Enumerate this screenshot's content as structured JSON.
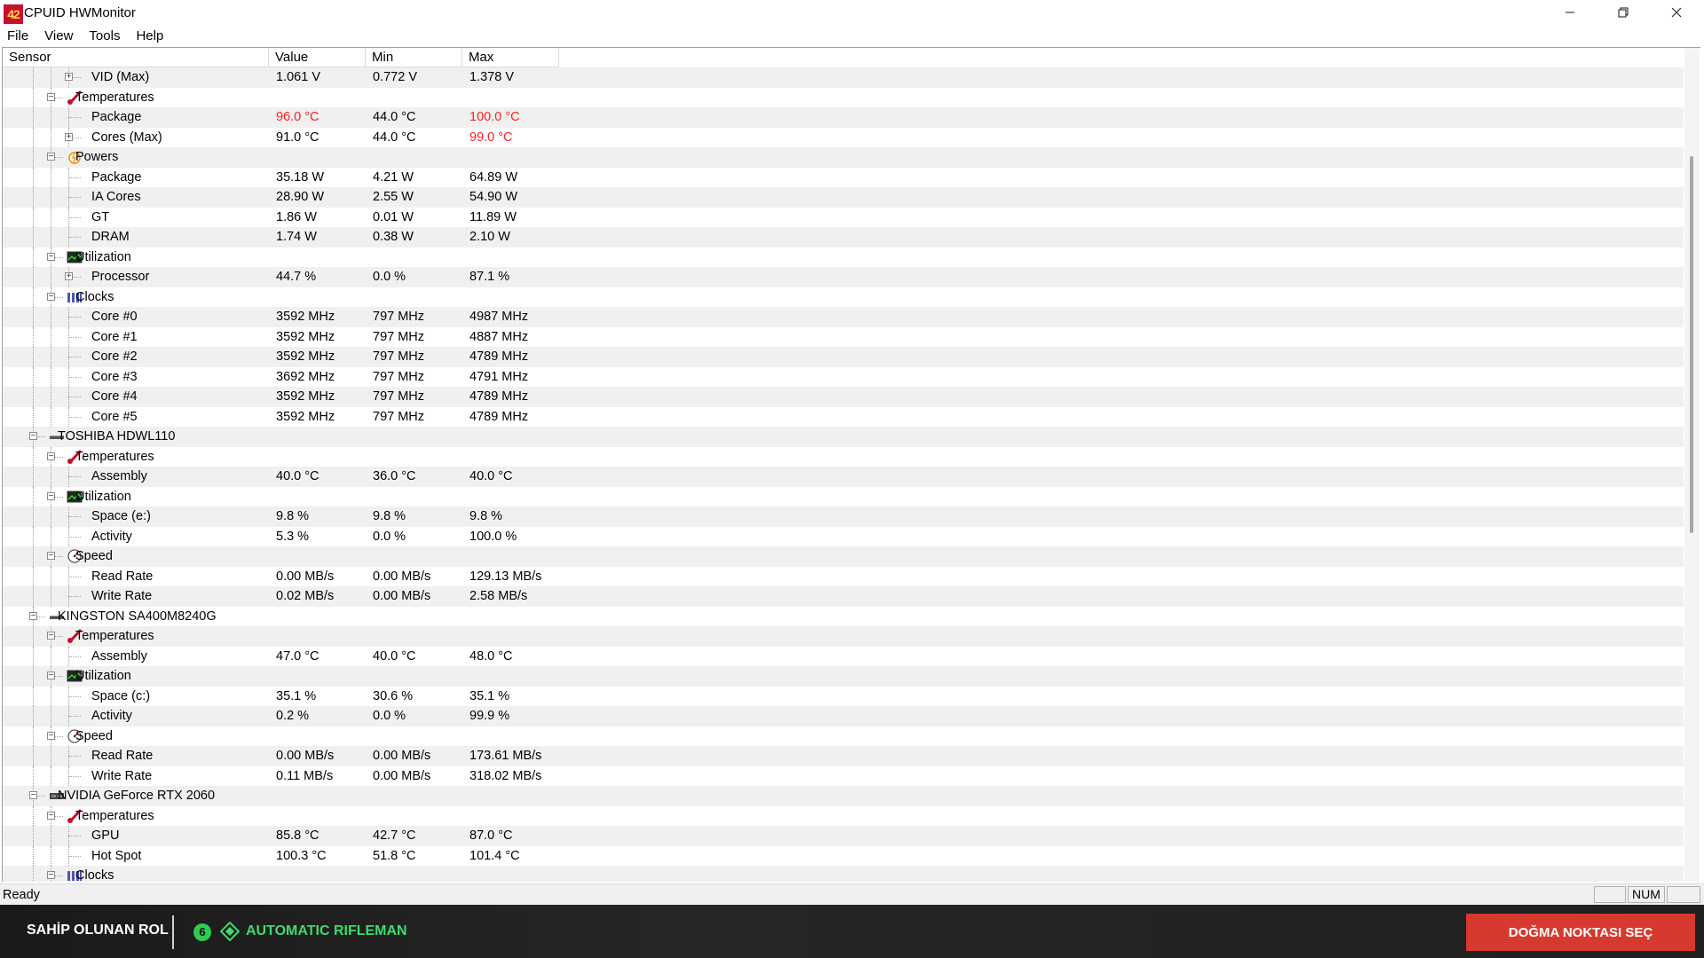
{
  "window": {
    "title": "CPUID HWMonitor",
    "icon_text": "42",
    "controls": [
      "minimize-icon",
      "restore-icon",
      "close-icon"
    ]
  },
  "menu": [
    "File",
    "View",
    "Tools",
    "Help"
  ],
  "columns": [
    "Sensor",
    "Value",
    "Min",
    "Max"
  ],
  "rows": [
    {
      "level": 3,
      "exp": "+",
      "icon": "",
      "name": "VID (Max)",
      "value": "1.061 V",
      "min": "0.772 V",
      "max": "1.378 V"
    },
    {
      "level": 2,
      "exp": "-",
      "icon": "thermometer-icon",
      "name": "Temperatures",
      "value": "",
      "min": "",
      "max": ""
    },
    {
      "level": 3,
      "exp": "",
      "icon": "",
      "name": "Package",
      "value": "96.0 °C",
      "min": "44.0 °C",
      "max": "100.0 °C",
      "value_red": true,
      "max_red": true
    },
    {
      "level": 3,
      "exp": "+",
      "icon": "",
      "name": "Cores (Max)",
      "value": "91.0 °C",
      "min": "44.0 °C",
      "max": "99.0 °C",
      "max_red": true
    },
    {
      "level": 2,
      "exp": "-",
      "icon": "power-icon",
      "name": "Powers",
      "value": "",
      "min": "",
      "max": ""
    },
    {
      "level": 3,
      "exp": "",
      "icon": "",
      "name": "Package",
      "value": "35.18 W",
      "min": "4.21 W",
      "max": "64.89 W"
    },
    {
      "level": 3,
      "exp": "",
      "icon": "",
      "name": "IA Cores",
      "value": "28.90 W",
      "min": "2.55 W",
      "max": "54.90 W"
    },
    {
      "level": 3,
      "exp": "",
      "icon": "",
      "name": "GT",
      "value": "1.86 W",
      "min": "0.01 W",
      "max": "11.89 W"
    },
    {
      "level": 3,
      "exp": "",
      "icon": "",
      "name": "DRAM",
      "value": "1.74 W",
      "min": "0.38 W",
      "max": "2.10 W"
    },
    {
      "level": 2,
      "exp": "-",
      "icon": "utilization-icon",
      "name": "Utilization",
      "value": "",
      "min": "",
      "max": ""
    },
    {
      "level": 3,
      "exp": "+",
      "icon": "",
      "name": "Processor",
      "value": "44.7 %",
      "min": "0.0 %",
      "max": "87.1 %"
    },
    {
      "level": 2,
      "exp": "-",
      "icon": "clock-icon",
      "name": "Clocks",
      "value": "",
      "min": "",
      "max": ""
    },
    {
      "level": 3,
      "exp": "",
      "icon": "",
      "name": "Core #0",
      "value": "3592 MHz",
      "min": "797 MHz",
      "max": "4987 MHz"
    },
    {
      "level": 3,
      "exp": "",
      "icon": "",
      "name": "Core #1",
      "value": "3592 MHz",
      "min": "797 MHz",
      "max": "4887 MHz"
    },
    {
      "level": 3,
      "exp": "",
      "icon": "",
      "name": "Core #2",
      "value": "3592 MHz",
      "min": "797 MHz",
      "max": "4789 MHz"
    },
    {
      "level": 3,
      "exp": "",
      "icon": "",
      "name": "Core #3",
      "value": "3692 MHz",
      "min": "797 MHz",
      "max": "4791 MHz"
    },
    {
      "level": 3,
      "exp": "",
      "icon": "",
      "name": "Core #4",
      "value": "3592 MHz",
      "min": "797 MHz",
      "max": "4789 MHz"
    },
    {
      "level": 3,
      "exp": "",
      "icon": "",
      "name": "Core #5",
      "value": "3592 MHz",
      "min": "797 MHz",
      "max": "4789 MHz"
    },
    {
      "level": 1,
      "exp": "-",
      "icon": "drive-icon",
      "name": "TOSHIBA HDWL110",
      "value": "",
      "min": "",
      "max": ""
    },
    {
      "level": 2,
      "exp": "-",
      "icon": "thermometer-icon",
      "name": "Temperatures",
      "value": "",
      "min": "",
      "max": ""
    },
    {
      "level": 3,
      "exp": "",
      "icon": "",
      "name": "Assembly",
      "value": "40.0 °C",
      "min": "36.0 °C",
      "max": "40.0 °C"
    },
    {
      "level": 2,
      "exp": "-",
      "icon": "utilization-icon",
      "name": "Utilization",
      "value": "",
      "min": "",
      "max": ""
    },
    {
      "level": 3,
      "exp": "",
      "icon": "",
      "name": "Space (e:)",
      "value": "9.8 %",
      "min": "9.8 %",
      "max": "9.8 %"
    },
    {
      "level": 3,
      "exp": "",
      "icon": "",
      "name": "Activity",
      "value": "5.3 %",
      "min": "0.0 %",
      "max": "100.0 %"
    },
    {
      "level": 2,
      "exp": "-",
      "icon": "speed-icon",
      "name": "Speed",
      "value": "",
      "min": "",
      "max": ""
    },
    {
      "level": 3,
      "exp": "",
      "icon": "",
      "name": "Read Rate",
      "value": "0.00 MB/s",
      "min": "0.00 MB/s",
      "max": "129.13 MB/s"
    },
    {
      "level": 3,
      "exp": "",
      "icon": "",
      "name": "Write Rate",
      "value": "0.02 MB/s",
      "min": "0.00 MB/s",
      "max": "2.58 MB/s"
    },
    {
      "level": 1,
      "exp": "-",
      "icon": "drive-icon",
      "name": "KINGSTON SA400M8240G",
      "value": "",
      "min": "",
      "max": ""
    },
    {
      "level": 2,
      "exp": "-",
      "icon": "thermometer-icon",
      "name": "Temperatures",
      "value": "",
      "min": "",
      "max": ""
    },
    {
      "level": 3,
      "exp": "",
      "icon": "",
      "name": "Assembly",
      "value": "47.0 °C",
      "min": "40.0 °C",
      "max": "48.0 °C"
    },
    {
      "level": 2,
      "exp": "-",
      "icon": "utilization-icon",
      "name": "Utilization",
      "value": "",
      "min": "",
      "max": ""
    },
    {
      "level": 3,
      "exp": "",
      "icon": "",
      "name": "Space (c:)",
      "value": "35.1 %",
      "min": "30.6 %",
      "max": "35.1 %"
    },
    {
      "level": 3,
      "exp": "",
      "icon": "",
      "name": "Activity",
      "value": "0.2 %",
      "min": "0.0 %",
      "max": "99.9 %"
    },
    {
      "level": 2,
      "exp": "-",
      "icon": "speed-icon",
      "name": "Speed",
      "value": "",
      "min": "",
      "max": ""
    },
    {
      "level": 3,
      "exp": "",
      "icon": "",
      "name": "Read Rate",
      "value": "0.00 MB/s",
      "min": "0.00 MB/s",
      "max": "173.61 MB/s"
    },
    {
      "level": 3,
      "exp": "",
      "icon": "",
      "name": "Write Rate",
      "value": "0.11 MB/s",
      "min": "0.00 MB/s",
      "max": "318.02 MB/s"
    },
    {
      "level": 1,
      "exp": "-",
      "icon": "gpu-icon",
      "name": "NVIDIA GeForce RTX 2060",
      "value": "",
      "min": "",
      "max": ""
    },
    {
      "level": 2,
      "exp": "-",
      "icon": "thermometer-icon",
      "name": "Temperatures",
      "value": "",
      "min": "",
      "max": ""
    },
    {
      "level": 3,
      "exp": "",
      "icon": "",
      "name": "GPU",
      "value": "85.8 °C",
      "min": "42.7 °C",
      "max": "87.0 °C"
    },
    {
      "level": 3,
      "exp": "",
      "icon": "",
      "name": "Hot Spot",
      "value": "100.3 °C",
      "min": "51.8 °C",
      "max": "101.4 °C"
    },
    {
      "level": 2,
      "exp": "-",
      "icon": "clock-icon",
      "name": "Clocks",
      "value": "",
      "min": "",
      "max": ""
    }
  ],
  "status": {
    "text": "Ready",
    "num": "NUM"
  },
  "colors": {
    "alert": "#ff2020",
    "accent_green": "#3ddc6b",
    "spawn_button": "#d63a2f"
  },
  "gamebar": {
    "role_label": "SAHİP OLUNAN ROL",
    "badge": "6",
    "class_name": "AUTOMATIC RIFLEMAN",
    "spawn_button": "DOĞMA NOKTASI SEÇ"
  }
}
